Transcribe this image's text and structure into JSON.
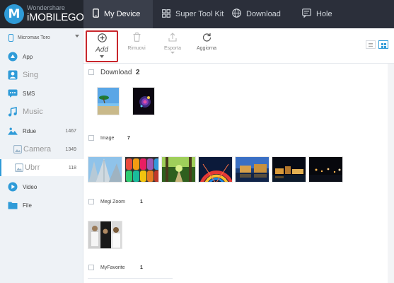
{
  "app": {
    "brand_small": "Wondershare",
    "brand_big": "iMOBILEGO›",
    "logo_letter": "M"
  },
  "tabs": [
    {
      "label": "My Device",
      "icon": "phone-icon",
      "active": true
    },
    {
      "label": "Super Tool Kit",
      "icon": "grid-icon",
      "active": false
    },
    {
      "label": "Download",
      "icon": "globe-icon",
      "active": false
    },
    {
      "label": "Hole",
      "icon": "chat-icon",
      "active": false
    }
  ],
  "sidebar": {
    "device_name": "Micromax Toro",
    "items": [
      {
        "label": "App",
        "icon": "apps-icon",
        "count": ""
      },
      {
        "label": "Sing",
        "icon": "person-icon",
        "count": ""
      },
      {
        "label": "SMS",
        "icon": "sms-icon",
        "count": ""
      },
      {
        "label": "Music",
        "icon": "music-icon",
        "count": ""
      },
      {
        "label": "Rdue",
        "icon": "photo-icon",
        "count": "1467"
      },
      {
        "label": "Camera",
        "icon": "camera-icon",
        "count": "1349"
      },
      {
        "label": "Ubrr",
        "icon": "library-icon",
        "count": "118"
      },
      {
        "label": "Video",
        "icon": "video-icon",
        "count": ""
      },
      {
        "label": "File",
        "icon": "folder-icon",
        "count": ""
      }
    ]
  },
  "toolbar": {
    "add_label": "Add",
    "remove_label": "Rimuovi",
    "export_label": "Esporta",
    "refresh_label": "Aggiorna"
  },
  "albums": [
    {
      "name": "Download",
      "count": "2"
    },
    {
      "name": "Image",
      "count": "7"
    },
    {
      "name": "Megi Zoom",
      "count": "1"
    },
    {
      "name": "MyFavorite",
      "count": "1"
    }
  ],
  "colors": {
    "accent": "#2f9bd8",
    "topbar": "#2b2f3a",
    "highlight_border": "#c8262c",
    "sidebar_bg": "#eef2f6"
  }
}
